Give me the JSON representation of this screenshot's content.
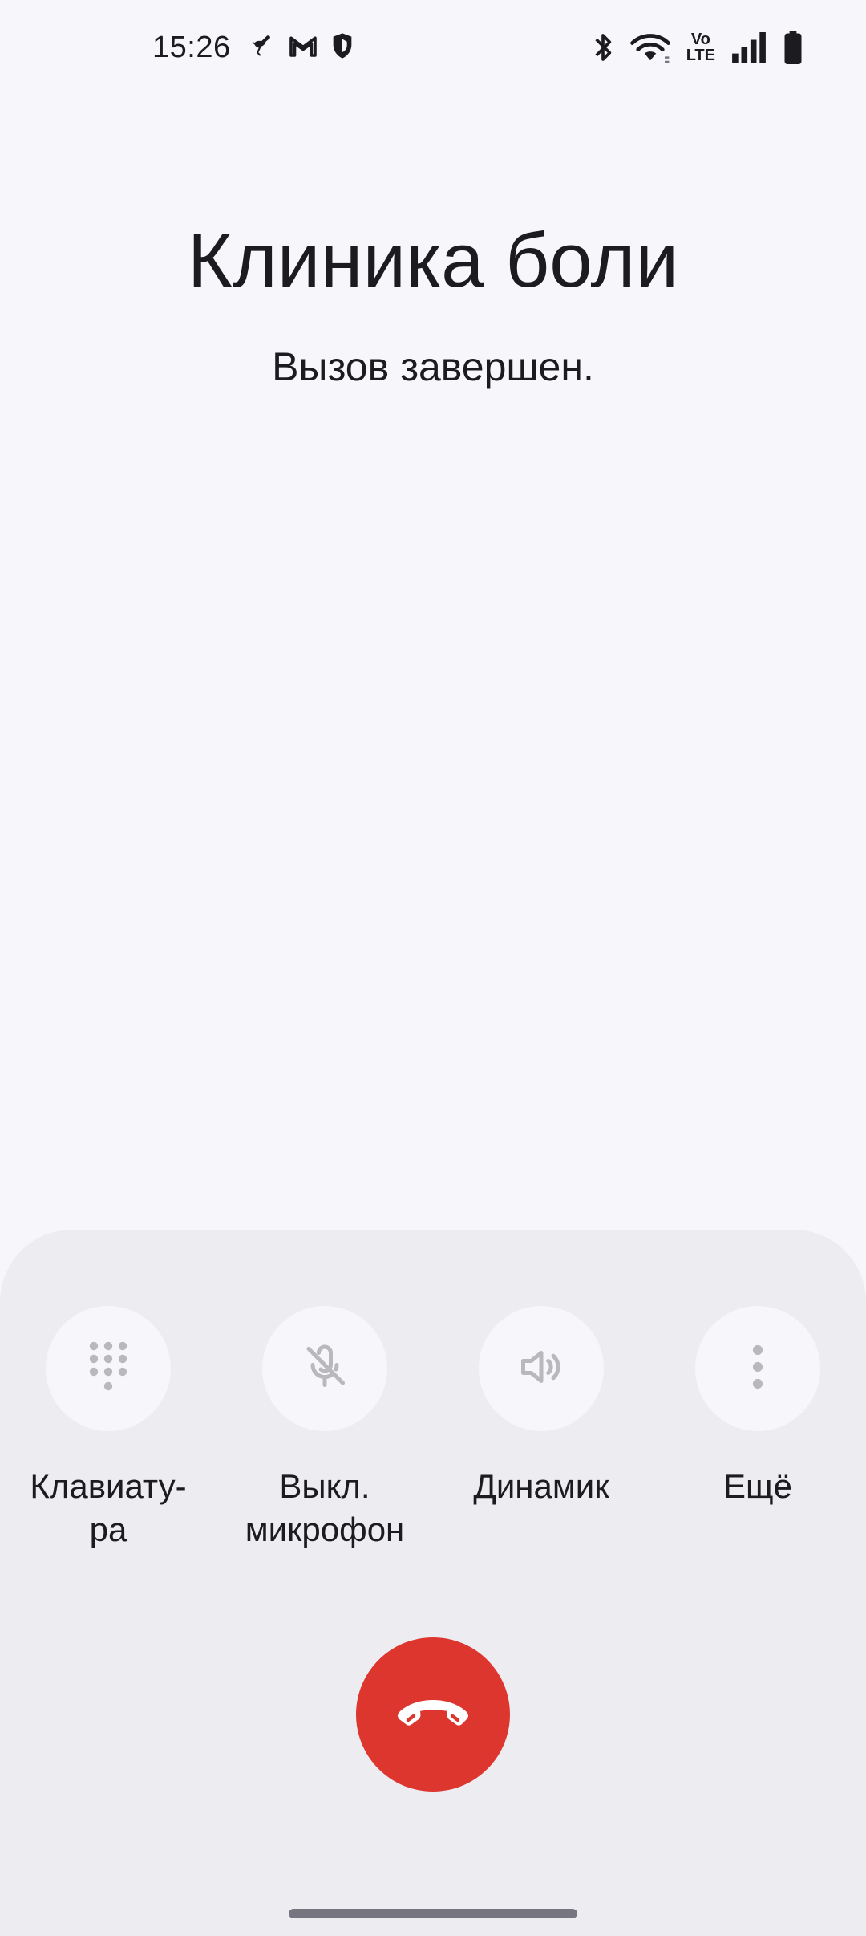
{
  "status_bar": {
    "time": "15:26",
    "left_icons": [
      "ostrich-icon",
      "gmail-icon",
      "shield-icon"
    ],
    "right_icons": [
      "bluetooth-icon",
      "wifi-icon",
      "volte-icon",
      "signal-icon",
      "battery-icon"
    ],
    "volte_top": "Vo",
    "volte_bottom": "LTE"
  },
  "caller": {
    "name": "Клиника боли",
    "status": "Вызов завершен."
  },
  "actions": [
    {
      "label": "Клавиату-\nра",
      "icon": "dialpad-icon"
    },
    {
      "label": "Выкл.\nмикрофон",
      "icon": "mic-off-icon"
    },
    {
      "label": "Динамик",
      "icon": "speaker-icon"
    },
    {
      "label": "Ещё",
      "icon": "more-vert-icon"
    }
  ],
  "end_call": {
    "icon": "end-call-icon",
    "color": "#dc362e"
  },
  "colors": {
    "background": "#f7f6fb",
    "sheet": "#edecf1",
    "disabled_icon": "#b9b8bd"
  }
}
